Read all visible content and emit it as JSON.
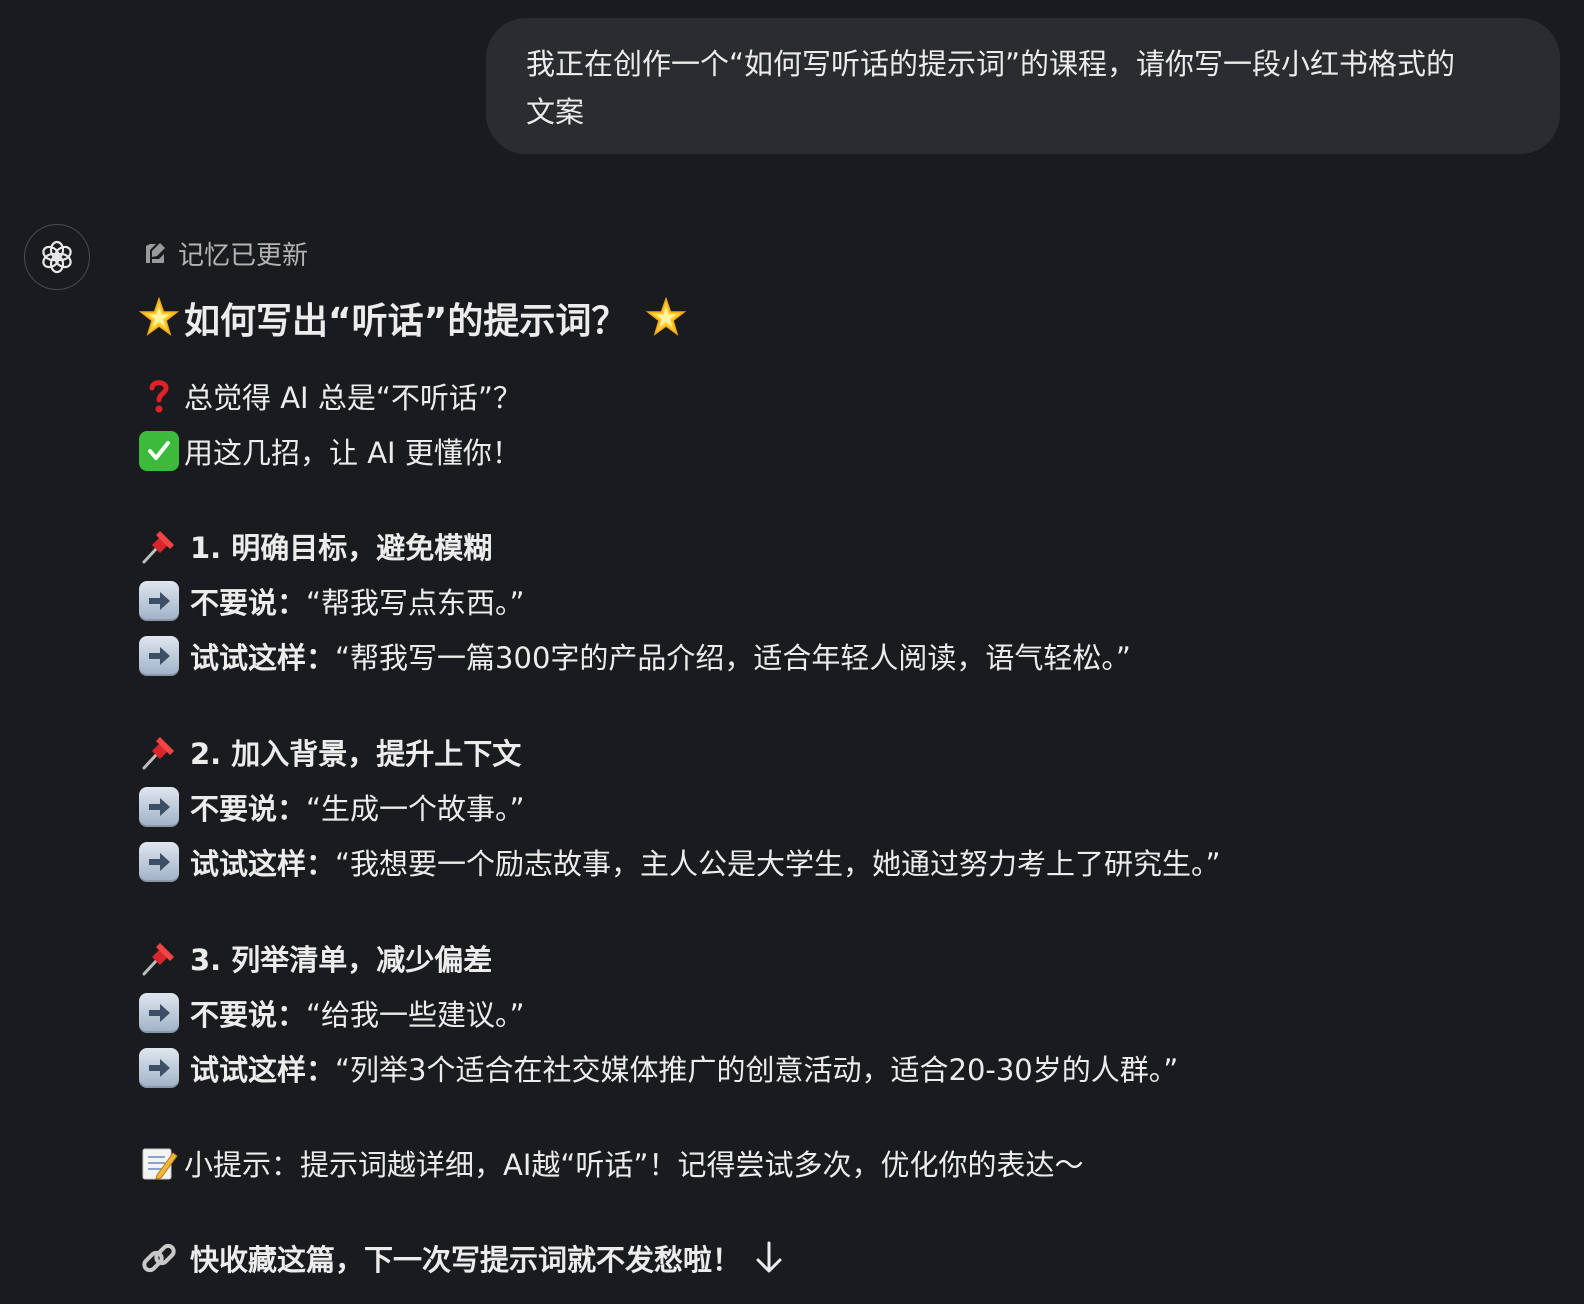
{
  "user_message": {
    "line1": "我正在创作一个“如何写听话的提示词”的课程，请你写一段小红书格式的",
    "line2": "文案"
  },
  "assistant": {
    "avatar_icon": "openai-logo-icon",
    "memory_status": "记忆已更新",
    "title": "如何写出“听话”的提示词？",
    "intro": [
      {
        "icon": "red-question-mark-icon",
        "text": "总觉得 AI 总是“不听话”？"
      },
      {
        "icon": "check-mark-button-icon",
        "text": "用这几招，让 AI 更懂你！"
      }
    ],
    "tips": [
      {
        "heading": "1. 明确目标，避免模糊",
        "dont_label": "不要说：",
        "dont_text": "“帮我写点东西。”",
        "try_label": "试试这样：",
        "try_text": "“帮我写一篇300字的产品介绍，适合年轻人阅读，语气轻松。”"
      },
      {
        "heading": "2. 加入背景，提升上下文",
        "dont_label": "不要说：",
        "dont_text": "“生成一个故事。”",
        "try_label": "试试这样：",
        "try_text": "“我想要一个励志故事，主人公是大学生，她通过努力考上了研究生。”"
      },
      {
        "heading": "3. 列举清单，减少偏差",
        "dont_label": "不要说：",
        "dont_text": "“给我一些建议。”",
        "try_label": "试试这样：",
        "try_text": "“列举3个适合在社交媒体推广的创意活动，适合20-30岁的人群。”"
      }
    ],
    "memo_tip": "小提示：提示词越详细，AI越“听话”！记得尝试多次，优化你的表达～",
    "closing": "快收藏这篇，下一次写提示词就不发愁啦！"
  },
  "colors": {
    "background": "#1a1b1e",
    "user_bubble": "#2b2c30",
    "text": "#ececec",
    "muted": "#b4b4b4"
  }
}
